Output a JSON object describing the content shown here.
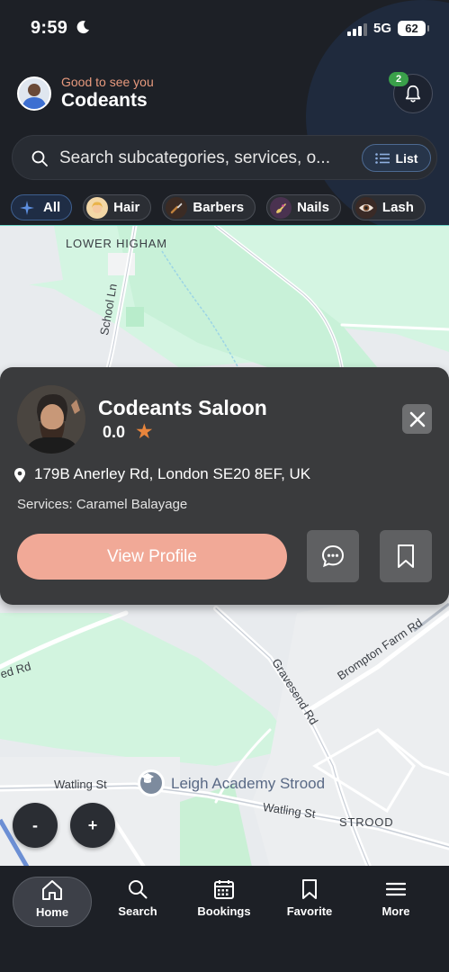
{
  "status_bar": {
    "time": "9:59",
    "network": "5G",
    "battery": "62"
  },
  "header": {
    "greeting": "Good to see you",
    "user_name": "Codeants",
    "notification_count": "2"
  },
  "search": {
    "placeholder": "Search subcategories, services, o...",
    "list_label": "List"
  },
  "categories": [
    {
      "label": "All",
      "icon": "sparkle-icon",
      "active": true
    },
    {
      "label": "Hair",
      "icon": "hair-icon",
      "active": false
    },
    {
      "label": "Barbers",
      "icon": "razor-icon",
      "active": false
    },
    {
      "label": "Nails",
      "icon": "nail-polish-icon",
      "active": false
    },
    {
      "label": "Lash",
      "icon": "eye-icon",
      "active": false
    }
  ],
  "map": {
    "labels": {
      "lower_higham": "LOWER HIGHAM",
      "school_ln": "School Ln",
      "ed_rd": "ed Rd",
      "gravesend_rd": "Gravesend Rd",
      "brompton_farm_rd": "Brompton Farm Rd",
      "watling_st_1": "Watling St",
      "watling_st_2": "Watling St",
      "strood": "STROOD"
    },
    "poi": "Leigh Academy Strood",
    "zoom_out": "-",
    "zoom_in": "+"
  },
  "salon_card": {
    "name": "Codeants Saloon",
    "rating": "0.0",
    "address": "179B Anerley Rd, London SE20 8EF, UK",
    "services": "Services: Caramel Balayage",
    "view_profile_label": "View Profile"
  },
  "bottom_nav": [
    {
      "label": "Home",
      "icon": "home-icon",
      "active": true
    },
    {
      "label": "Search",
      "icon": "search-icon",
      "active": false
    },
    {
      "label": "Bookings",
      "icon": "calendar-icon",
      "active": false
    },
    {
      "label": "Favorite",
      "icon": "bookmark-icon",
      "active": false
    },
    {
      "label": "More",
      "icon": "menu-icon",
      "active": false
    }
  ],
  "colors": {
    "accent": "#f1a997",
    "greeting": "#e89a7e",
    "star": "#e8853c",
    "badge": "#3aa04a",
    "background": "#1d2026"
  }
}
